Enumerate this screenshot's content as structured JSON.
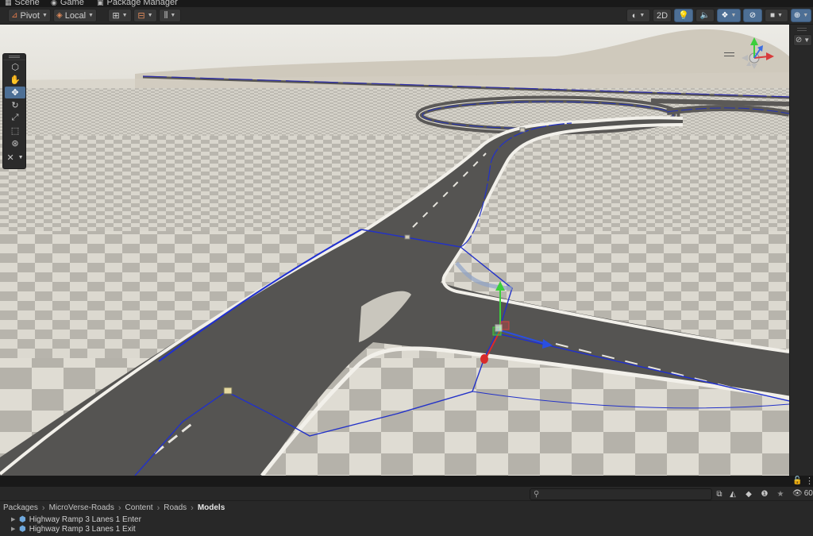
{
  "tabs": [
    {
      "label": "Scene",
      "icon": "grid-icon"
    },
    {
      "label": "Game",
      "icon": "gamepad-icon"
    },
    {
      "label": "Package Manager",
      "icon": "package-icon"
    }
  ],
  "toolbar": {
    "pivot_label": "Pivot",
    "local_label": "Local",
    "view_2d_label": "2D",
    "accent_color": "#4d6f95"
  },
  "tools": [
    "view-cube-tool",
    "hand-tool",
    "move-tool",
    "rotate-tool",
    "scale-tool",
    "rect-tool",
    "transform-tool",
    "custom-editor-tool"
  ],
  "project": {
    "search_placeholder": "",
    "visible_count": "60",
    "breadcrumbs": [
      "Packages",
      "MicroVerse-Roads",
      "Content",
      "Roads",
      "Models"
    ],
    "assets": [
      {
        "label": "Highway Ramp 3 Lanes 1 Enter"
      },
      {
        "label": "Highway Ramp 3 Lanes 1 Exit"
      }
    ]
  }
}
